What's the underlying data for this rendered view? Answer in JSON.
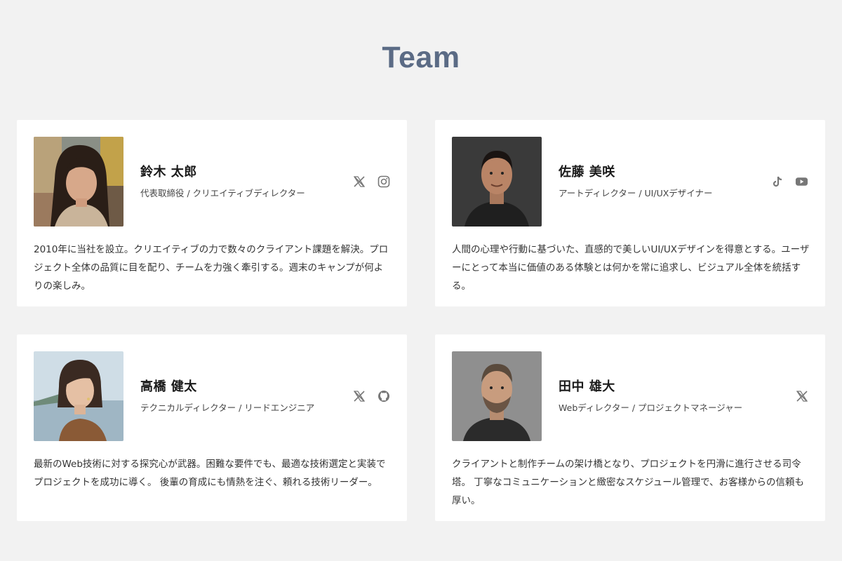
{
  "page": {
    "title": "Team"
  },
  "members": [
    {
      "name": "鈴木 太郎",
      "role": "代表取締役 / クリエイティブディレクター",
      "bio": "2010年に当社を設立。クリエイティブの力で数々のクライアント課題を解決。プロジェクト全体の品質に目を配り、チームを力強く牽引する。週末のキャンプが何よりの楽しみ。",
      "socials": [
        "x-icon",
        "instagram-icon"
      ]
    },
    {
      "name": "佐藤 美咲",
      "role": "アートディレクター / UI/UXデザイナー",
      "bio": "人間の心理や行動に基づいた、直感的で美しいUI/UXデザインを得意とする。ユーザーにとって本当に価値のある体験とは何かを常に追求し、ビジュアル全体を統括する。",
      "socials": [
        "tiktok-icon",
        "youtube-icon"
      ]
    },
    {
      "name": "高橋 健太",
      "role": "テクニカルディレクター / リードエンジニア",
      "bio": "最新のWeb技術に対する探究心が武器。困難な要件でも、最適な技術選定と実装でプロジェクトを成功に導く。 後輩の育成にも情熱を注ぐ、頼れる技術リーダー。",
      "socials": [
        "x-icon",
        "github-icon"
      ]
    },
    {
      "name": "田中 雄大",
      "role": "Webディレクター / プロジェクトマネージャー",
      "bio": "クライアントと制作チームの架け橋となり、プロジェクトを円滑に進行させる司令塔。 丁寧なコミュニケーションと緻密なスケジュール管理で、お客様からの信頼も厚い。",
      "socials": [
        "x-icon"
      ]
    }
  ],
  "colors": {
    "background": "#f2f2f2",
    "card": "#ffffff",
    "title": "#5b6b85",
    "icon": "#777777"
  }
}
